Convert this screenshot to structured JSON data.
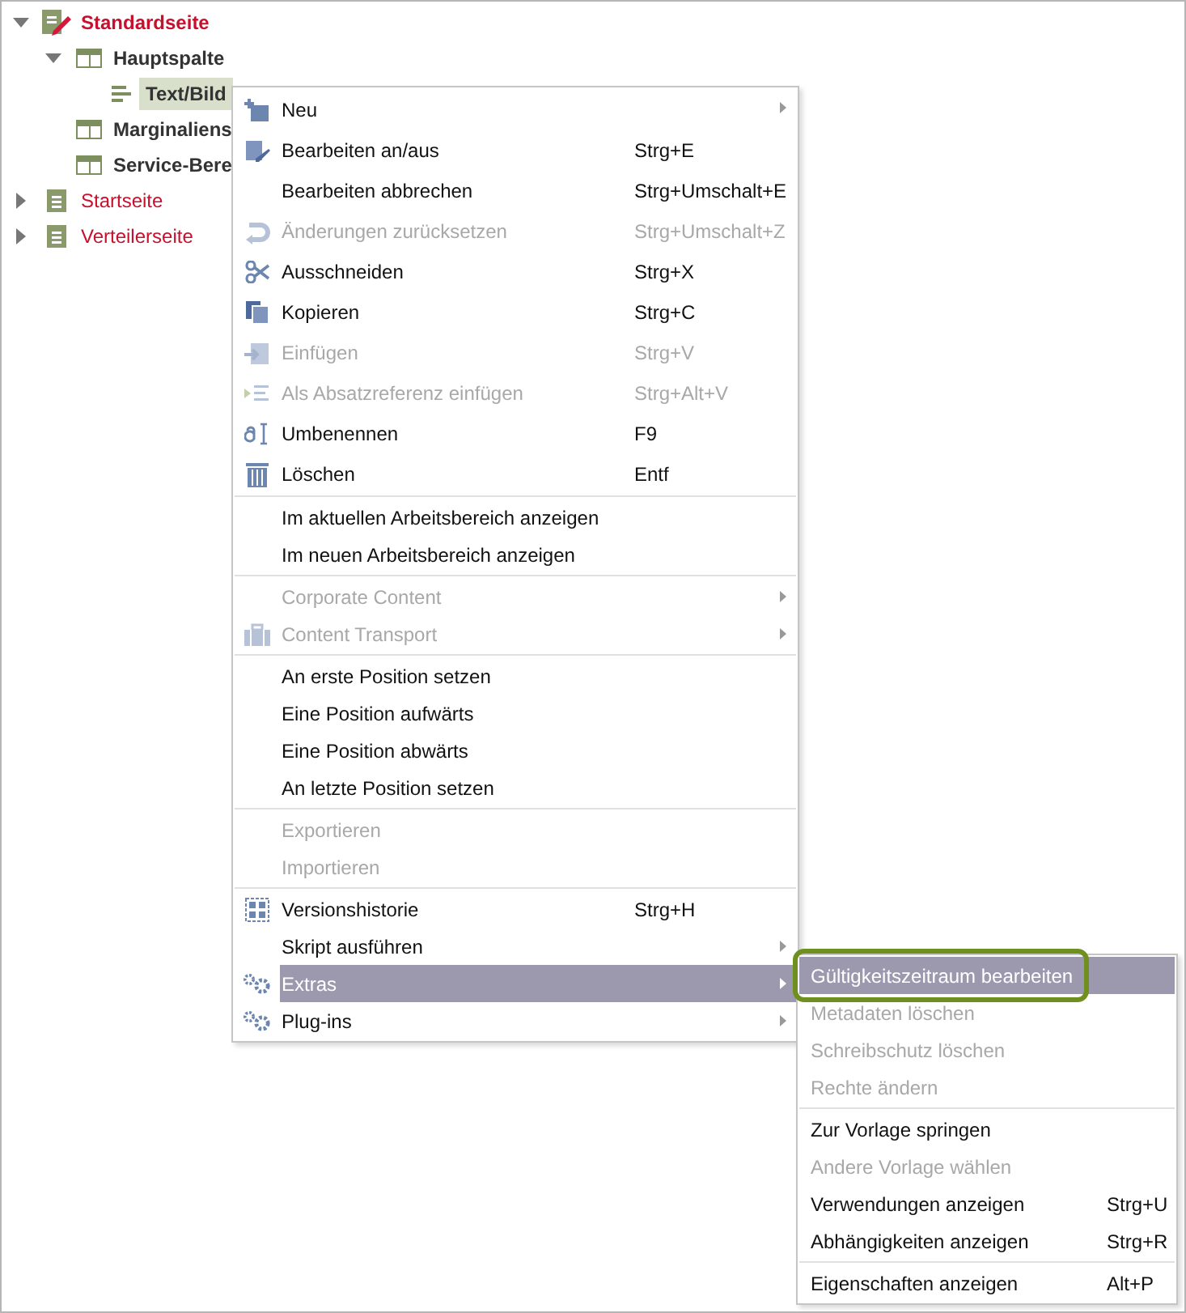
{
  "tree": [
    {
      "label": "Standardseite",
      "kind": "page",
      "bold": true,
      "expanded": true,
      "children": [
        {
          "label": "Hauptspalte",
          "kind": "column",
          "bold": true,
          "expanded": true,
          "selected": false,
          "children": [
            {
              "label": "Text/Bild",
              "kind": "paragraph",
              "bold": true,
              "selected": true
            }
          ]
        },
        {
          "label": "Marginaliens",
          "kind": "column",
          "bold": true,
          "selected": false
        },
        {
          "label": "Service-Bere",
          "kind": "column",
          "bold": true,
          "selected": false
        }
      ],
      "selected": false
    },
    {
      "label": "Startseite",
      "kind": "page",
      "bold": false,
      "expanded": false,
      "selected": false
    },
    {
      "label": "Verteilerseite",
      "kind": "page",
      "bold": false,
      "expanded": false,
      "selected": false
    }
  ],
  "context_menu": {
    "groups": [
      [
        {
          "label": "Neu",
          "kind": "new",
          "has_submenu": true,
          "disabled": false,
          "selected": false
        },
        {
          "label": "Bearbeiten an/aus",
          "shortcut": "Strg+E",
          "kind": "edit",
          "has_submenu": false,
          "disabled": false,
          "selected": false
        },
        {
          "label": "Bearbeiten abbrechen",
          "shortcut": "Strg+Umschalt+E",
          "kind": "plain",
          "has_submenu": false,
          "disabled": false,
          "selected": false
        },
        {
          "label": "Änderungen zurücksetzen",
          "shortcut": "Strg+Umschalt+Z",
          "kind": "undo",
          "has_submenu": false,
          "disabled": true,
          "selected": false
        },
        {
          "label": "Ausschneiden",
          "shortcut": "Strg+X",
          "kind": "cut",
          "has_submenu": false,
          "disabled": false,
          "selected": false
        },
        {
          "label": "Kopieren",
          "shortcut": "Strg+C",
          "kind": "copy",
          "has_submenu": false,
          "disabled": false,
          "selected": false
        },
        {
          "label": "Einfügen",
          "shortcut": "Strg+V",
          "kind": "paste",
          "has_submenu": false,
          "disabled": true,
          "selected": false
        },
        {
          "label": "Als Absatzreferenz einfügen",
          "shortcut": "Strg+Alt+V",
          "kind": "reference",
          "has_submenu": false,
          "disabled": true,
          "selected": false
        },
        {
          "label": "Umbenennen",
          "shortcut": "F9",
          "kind": "rename",
          "has_submenu": false,
          "disabled": false,
          "selected": false
        },
        {
          "label": "Löschen",
          "shortcut": "Entf",
          "kind": "delete",
          "has_submenu": false,
          "disabled": false,
          "selected": false
        }
      ],
      [
        {
          "label": "Im aktuellen Arbeitsbereich anzeigen",
          "kind": "plain",
          "has_submenu": false,
          "disabled": false,
          "selected": false
        },
        {
          "label": "Im neuen Arbeitsbereich anzeigen",
          "kind": "plain",
          "has_submenu": false,
          "disabled": false,
          "selected": false
        }
      ],
      [
        {
          "label": "Corporate Content",
          "kind": "plain",
          "has_submenu": true,
          "disabled": true,
          "selected": false
        },
        {
          "label": "Content Transport",
          "kind": "transport",
          "has_submenu": true,
          "disabled": true,
          "selected": false
        }
      ],
      [
        {
          "label": "An erste Position setzen",
          "kind": "plain",
          "has_submenu": false,
          "disabled": false,
          "selected": false
        },
        {
          "label": "Eine Position aufwärts",
          "kind": "plain",
          "has_submenu": false,
          "disabled": false,
          "selected": false
        },
        {
          "label": "Eine Position abwärts",
          "kind": "plain",
          "has_submenu": false,
          "disabled": false,
          "selected": false
        },
        {
          "label": "An letzte Position setzen",
          "kind": "plain",
          "has_submenu": false,
          "disabled": false,
          "selected": false
        }
      ],
      [
        {
          "label": "Exportieren",
          "kind": "plain",
          "has_submenu": false,
          "disabled": true,
          "selected": false
        },
        {
          "label": "Importieren",
          "kind": "plain",
          "has_submenu": false,
          "disabled": true,
          "selected": false
        }
      ],
      [
        {
          "label": "Versionshistorie",
          "shortcut": "Strg+H",
          "kind": "history",
          "has_submenu": false,
          "disabled": false,
          "selected": false
        },
        {
          "label": "Skript ausführen",
          "kind": "plain",
          "has_submenu": true,
          "disabled": false,
          "selected": false
        },
        {
          "label": "Extras",
          "kind": "gears",
          "has_submenu": true,
          "disabled": false,
          "selected": true
        },
        {
          "label": "Plug-ins",
          "kind": "gears",
          "has_submenu": true,
          "disabled": false,
          "selected": false
        }
      ]
    ]
  },
  "submenu": {
    "groups": [
      [
        {
          "label": "Gültigkeitszeitraum bearbeiten",
          "disabled": false,
          "selected": true,
          "outlined": true
        },
        {
          "label": "Metadaten löschen",
          "disabled": true,
          "selected": false,
          "outlined": false
        },
        {
          "label": "Schreibschutz löschen",
          "disabled": true,
          "selected": false,
          "outlined": false
        },
        {
          "label": "Rechte ändern",
          "disabled": true,
          "selected": false,
          "outlined": false
        }
      ],
      [
        {
          "label": "Zur Vorlage springen",
          "disabled": false,
          "selected": false,
          "outlined": false
        },
        {
          "label": "Andere Vorlage wählen",
          "disabled": true,
          "selected": false,
          "outlined": false
        },
        {
          "label": "Verwendungen anzeigen",
          "shortcut": "Strg+U",
          "disabled": false,
          "selected": false,
          "outlined": false
        },
        {
          "label": "Abhängigkeiten anzeigen",
          "shortcut": "Strg+R",
          "disabled": false,
          "selected": false,
          "outlined": false
        }
      ],
      [
        {
          "label": "Eigenschaften anzeigen",
          "shortcut": "Alt+P",
          "disabled": false,
          "selected": false,
          "outlined": false
        }
      ]
    ]
  }
}
